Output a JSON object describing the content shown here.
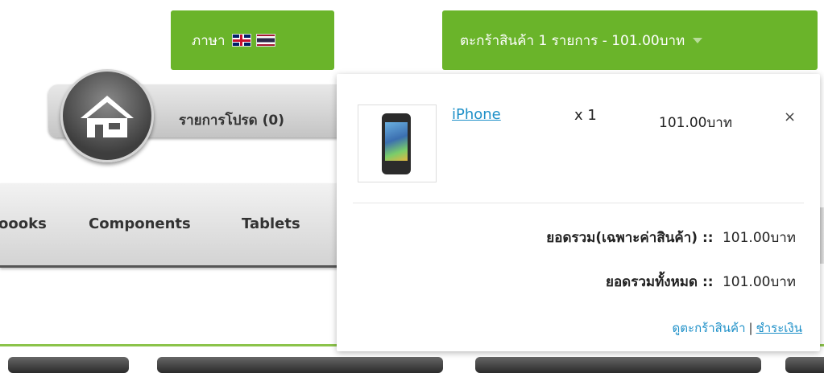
{
  "header": {
    "language_label": "ภาษา",
    "cart_button_label": "ตะกร้าสินค้า 1 รายการ - 101.00บาท"
  },
  "toolbar": {
    "wishlist_label": "รายการโปรด (0)"
  },
  "nav": {
    "items": [
      "oooks",
      "Components",
      "Tablets"
    ]
  },
  "cart_dropdown": {
    "item": {
      "name": "iPhone",
      "qty": "x 1",
      "price": "101.00บาท",
      "remove": "×"
    },
    "subtotal_label": "ยอดรวม(เฉพาะค่าสินค้า) ::",
    "subtotal_value": "101.00บาท",
    "total_label": "ยอดรวมทั้งหมด ::",
    "total_value": "101.00บาท",
    "view_cart_link": "ดูตะกร้าสินค้า",
    "separator": "|",
    "checkout_link": "ชำระเงิน"
  },
  "colors": {
    "accent_green": "#6ab42a",
    "link_blue": "#1e90c8"
  }
}
